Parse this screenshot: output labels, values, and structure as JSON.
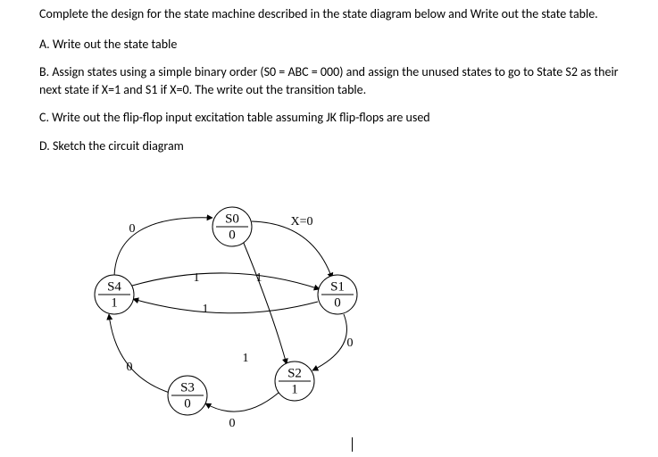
{
  "text": {
    "intro": "Complete the design for the state machine described in the state diagram below and Write out the state table.",
    "part_a": "A. Write out the state table",
    "part_b": "B. Assign states using a simple binary order (S0 = ABC = 000) and assign the unused states to go to State S2 as their next state if X=1 and S1 if X=0. The write out the transition table.",
    "part_c": "C. Write out the flip-flop input excitation table assuming JK flip-flops are used",
    "part_d": "D. Sketch the circuit diagram"
  },
  "diagram": {
    "input_label": "X=0",
    "states": {
      "s0": {
        "name": "S0",
        "output": "0"
      },
      "s1": {
        "name": "S1",
        "output": "0"
      },
      "s2": {
        "name": "S2",
        "output": "1"
      },
      "s3": {
        "name": "S3",
        "output": "0"
      },
      "s4": {
        "name": "S4",
        "output": "1"
      }
    },
    "edge_labels": {
      "s4_s0_0": "0",
      "s0_s1_x0": "X=0",
      "s4_s1_1": "1",
      "s0_s1_inner_1": "1",
      "s1_s4_1": "1",
      "s1_s2_0": "0",
      "s0_s2_1": "1",
      "s3_s4_0": "0",
      "s2_s3_0": "0"
    }
  }
}
